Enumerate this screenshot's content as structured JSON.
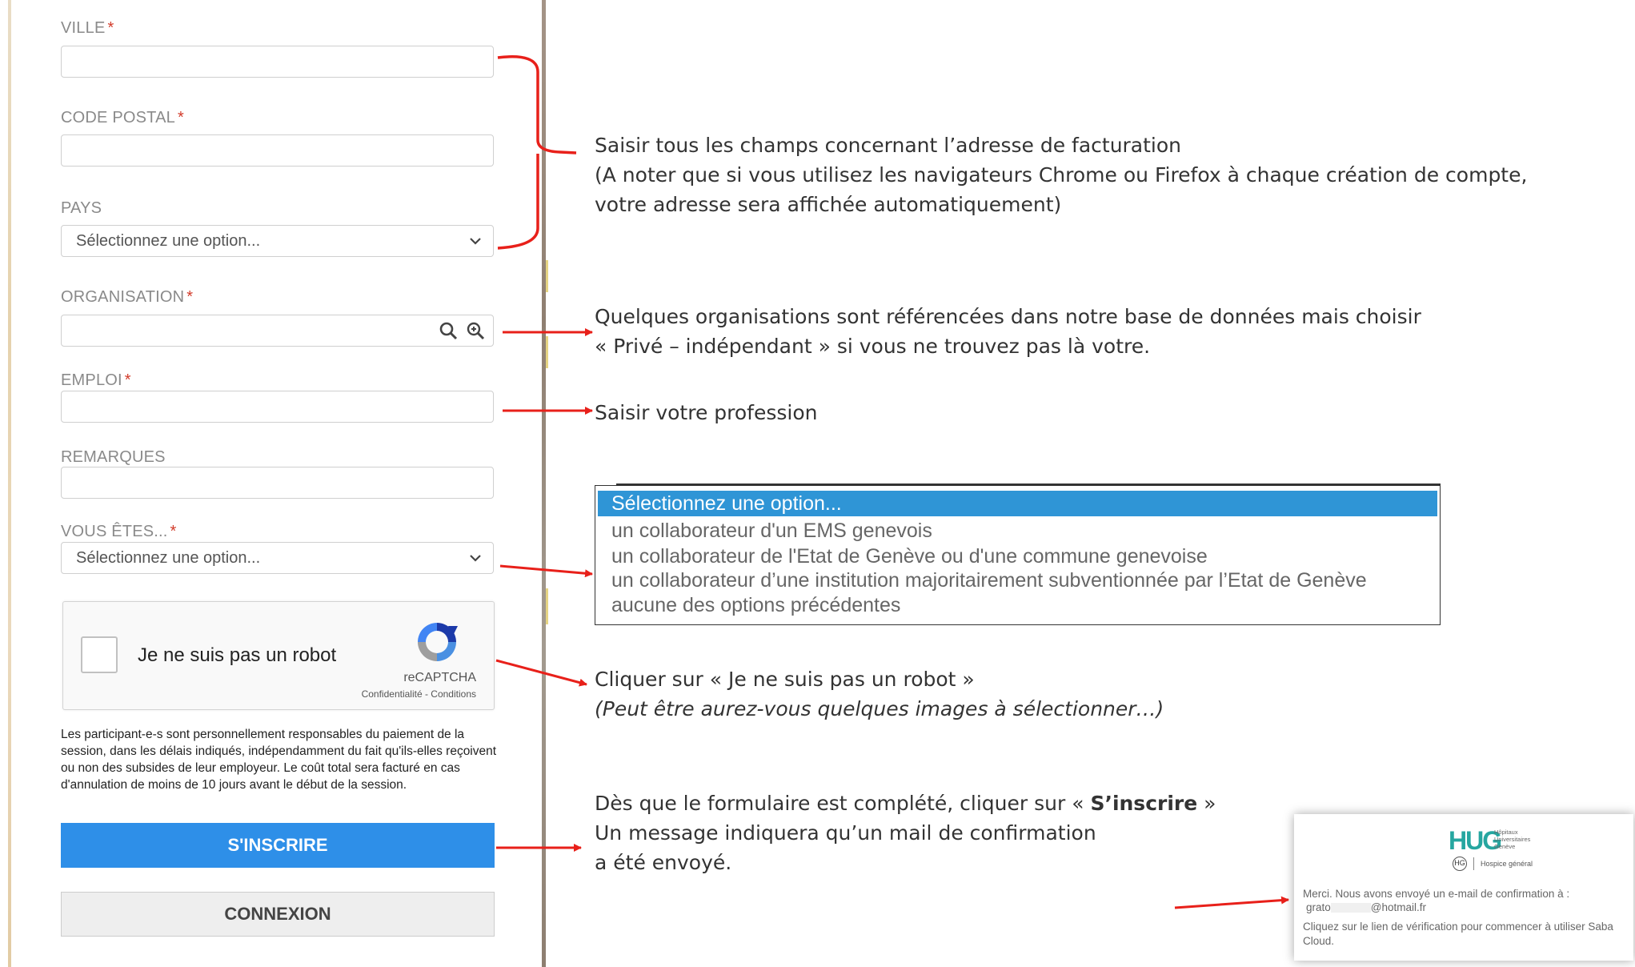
{
  "form": {
    "ville": {
      "label": "VILLE",
      "required_mark": "*"
    },
    "code_postal": {
      "label": "CODE POSTAL",
      "required_mark": "*"
    },
    "pays": {
      "label": "PAYS",
      "value": "Sélectionnez une option..."
    },
    "organisation": {
      "label": "ORGANISATION",
      "required_mark": "*"
    },
    "emploi": {
      "label": "EMPLOI",
      "required_mark": "*"
    },
    "remarques": {
      "label": "REMARQUES"
    },
    "vous_etes": {
      "label": "VOUS ÊTES...",
      "required_mark": "*",
      "value": "Sélectionnez une option..."
    },
    "captcha": {
      "label": "Je ne suis pas un robot",
      "brand": "reCAPTCHA",
      "links": "Confidentialité - Conditions"
    },
    "disclaimer": "Les participant-e-s sont personnellement responsables du paiement de la session, dans les délais indiqués, indépendamment du fait qu'ils-elles reçoivent ou non des subsides de leur employeur. Le coût total sera facturé en cas d'annulation de moins de 10 jours avant le début de la session.",
    "submit_label": "S'INSCRIRE",
    "login_label": "CONNEXION"
  },
  "annotations": {
    "address_line1": "Saisir tous les champs concernant l’adresse de facturation",
    "address_line2": "(A noter que si vous utilisez les navigateurs Chrome ou Firefox à chaque création de compte,",
    "address_line3": "votre adresse sera affichée automatiquement)",
    "org_line1": "Quelques organisations sont référencées dans notre base de données mais choisir",
    "org_line2": "« Privé – indépendant  » si vous ne trouvez pas là votre.",
    "emploi": "Saisir votre profession",
    "captcha_line1": "Cliquer sur « Je ne suis pas un robot »",
    "captcha_line2": "(Peut être aurez-vous quelques images à sélectionner…)",
    "submit_line1_pre": "Dès que le formulaire est complété,  cliquer sur « ",
    "submit_line1_bold": "S’inscrire",
    "submit_line1_post": " »",
    "submit_line2": "Un message indiquera qu’un mail de confirmation",
    "submit_line3": "a été envoyé."
  },
  "dropdown_options": [
    "Sélectionnez une option...",
    "un collaborateur d'un EMS genevois",
    "un collaborateur de l'Etat de Genève ou d'une commune genevoise",
    "un collaborateur d’une institution majoritairement subventionnée par l’Etat de Genève",
    "aucune des options précédentes"
  ],
  "confirmation": {
    "hug_logo": "HUG",
    "hug_subtitle": "Hôpitaux Universitaires Genève",
    "hg_logo": "HG",
    "hg_name": "Hospice général",
    "message": "Merci. Nous avons envoyé un e-mail de confirmation à :",
    "email_prefix": "grato",
    "email_suffix": "@hotmail.fr",
    "link_text": "Cliquez sur le lien de vérification pour commencer à utiliser Saba Cloud."
  },
  "colors": {
    "accent_blue": "#2e8fe8",
    "required_red": "#d23b2a",
    "arrow_red": "#e8201a",
    "selected_option": "#2f95d6"
  }
}
